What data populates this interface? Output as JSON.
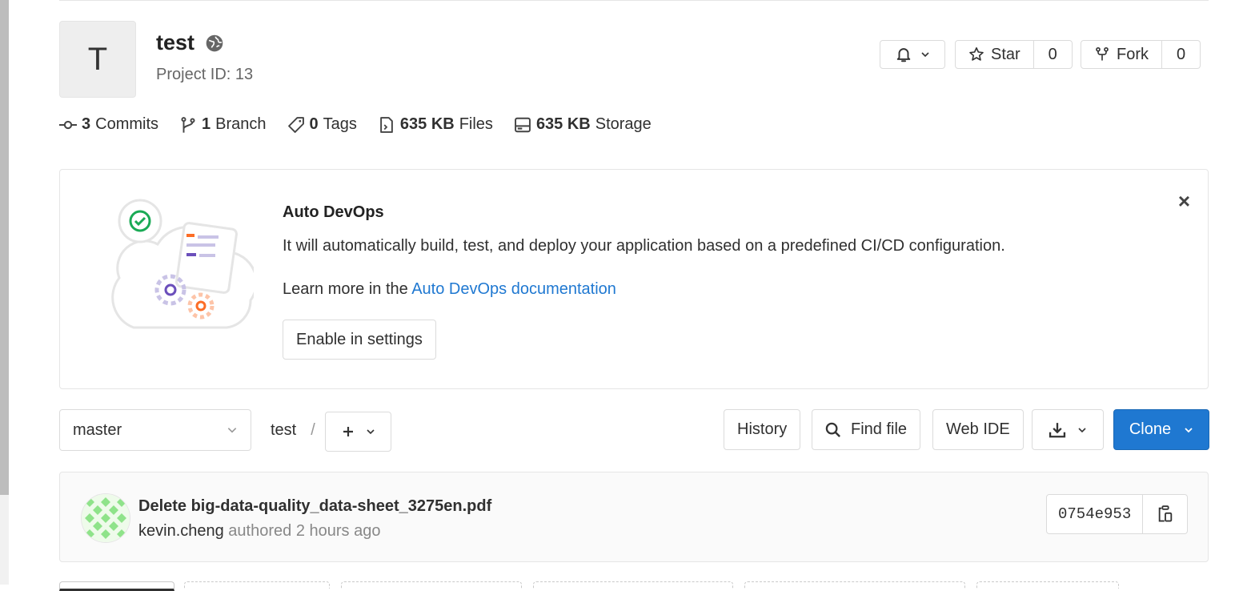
{
  "project": {
    "avatar_letter": "T",
    "name": "test",
    "project_id": "Project ID: 13",
    "visibility_icon": "globe-icon"
  },
  "actions": {
    "notification_icon": "bell-icon",
    "star_label": "Star",
    "star_count": "0",
    "fork_label": "Fork",
    "fork_count": "0"
  },
  "stats": [
    {
      "icon": "commit-icon",
      "value": "3",
      "label": "Commits"
    },
    {
      "icon": "branch-icon",
      "value": "1",
      "label": "Branch"
    },
    {
      "icon": "tag-icon",
      "value": "0",
      "label": "Tags"
    },
    {
      "icon": "file-icon",
      "value": "635 KB",
      "label": "Files"
    },
    {
      "icon": "storage-icon",
      "value": "635 KB",
      "label": "Storage"
    }
  ],
  "auto_devops": {
    "title": "Auto DevOps",
    "description": "It will automatically build, test, and deploy your application based on a predefined CI/CD configuration.",
    "learn_prefix": "Learn more in the ",
    "learn_link": "Auto DevOps documentation",
    "enable_button": "Enable in settings",
    "close_label": "×"
  },
  "repo_nav": {
    "branch": "master",
    "path_root": "test",
    "path_separator": "/",
    "history_button": "History",
    "find_file_button": "Find file",
    "web_ide_button": "Web IDE",
    "clone_button": "Clone"
  },
  "last_commit": {
    "title": "Delete big-data-quality_data-sheet_3275en.pdf",
    "author": "kevin.cheng",
    "authored_text": " authored 2 hours ago",
    "sha": "0754e953"
  },
  "colors": {
    "primary": "#1f78d1",
    "link": "#1f78d1",
    "border": "#dbdbdb",
    "devops_green": "#1aaa55",
    "devops_purple": "#6b4fbb",
    "devops_orange": "#fc6d26"
  }
}
